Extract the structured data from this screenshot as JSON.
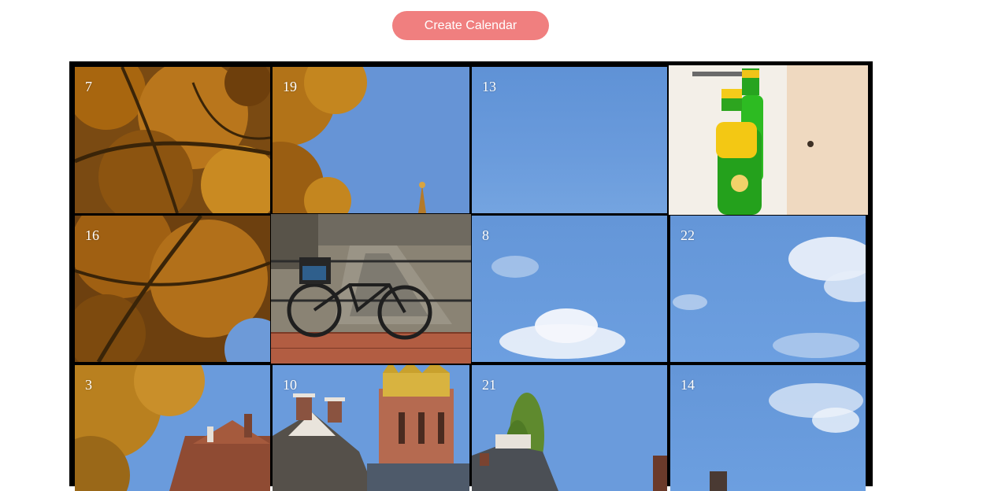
{
  "toolbar": {
    "create_label": "Create Calendar"
  },
  "calendar": {
    "doors": [
      {
        "number": "7",
        "scene": "autumn-tree-leaves"
      },
      {
        "number": "19",
        "scene": "tree-and-sky"
      },
      {
        "number": "13",
        "scene": "blue-sky"
      },
      {
        "number": "",
        "scene": "green-bottles"
      },
      {
        "number": "16",
        "scene": "autumn-tree-leaves"
      },
      {
        "number": "",
        "scene": "bicycle-by-canal"
      },
      {
        "number": "8",
        "scene": "sky-with-clouds"
      },
      {
        "number": "22",
        "scene": "sky-with-clouds"
      },
      {
        "number": "3",
        "scene": "tree-and-rooftops"
      },
      {
        "number": "10",
        "scene": "church-tower-rooftops"
      },
      {
        "number": "21",
        "scene": "poplar-and-rooftops"
      },
      {
        "number": "14",
        "scene": "sky-with-clouds"
      }
    ]
  },
  "colors": {
    "button_bg": "#f07f7f",
    "button_text": "#ffffff",
    "grid_border": "#000000",
    "sky_blue": "#6a9bdc"
  }
}
